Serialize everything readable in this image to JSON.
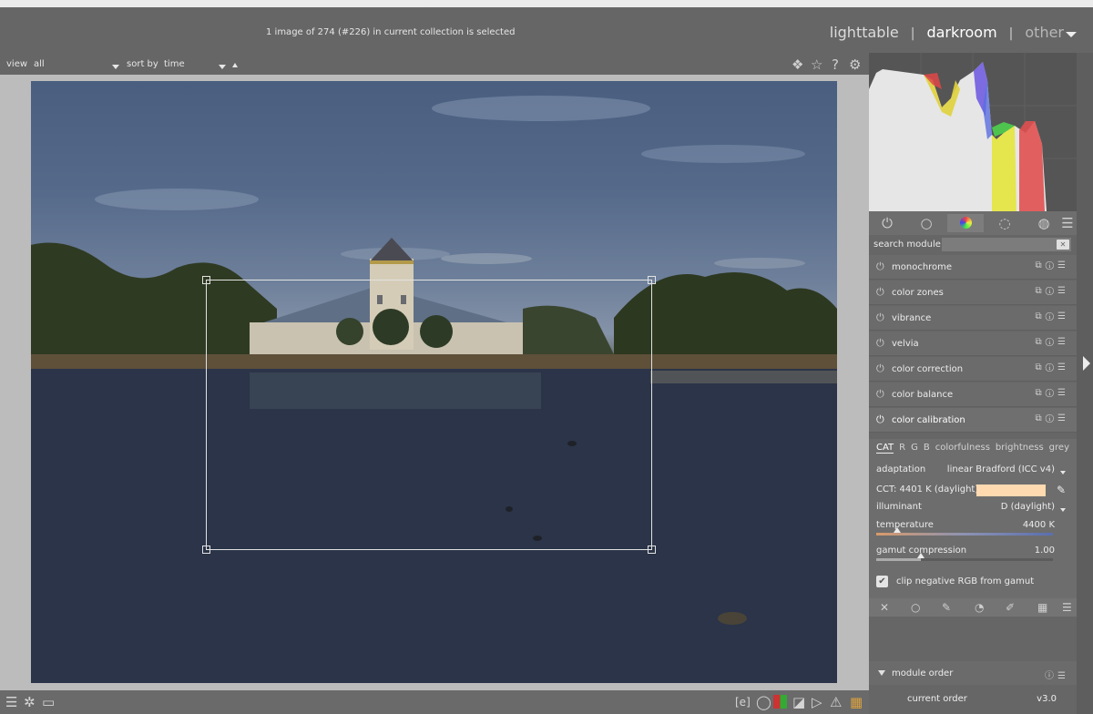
{
  "collection_status": "1 image of 274 (#226) in current collection is selected",
  "views": {
    "lighttable": "lighttable",
    "darkroom": "darkroom",
    "other": "other",
    "separator": "|"
  },
  "filterbar": {
    "view_label": "view",
    "view_value": "all",
    "sort_label": "sort by",
    "sort_value": "time"
  },
  "search": {
    "label": "search module",
    "value": ""
  },
  "modules": [
    {
      "name": "monochrome"
    },
    {
      "name": "color zones"
    },
    {
      "name": "vibrance"
    },
    {
      "name": "velvia"
    },
    {
      "name": "color correction"
    },
    {
      "name": "color balance"
    },
    {
      "name": "color calibration"
    }
  ],
  "color_calibration": {
    "tabs": [
      "CAT",
      "R",
      "G",
      "B",
      "colorfulness",
      "brightness",
      "grey"
    ],
    "adaptation_label": "adaptation",
    "adaptation_value": "linear Bradford (ICC v4)",
    "cct_label": "CCT: 4401 K (daylight)",
    "cct_color": "#ffd9b0",
    "illuminant_label": "illuminant",
    "illuminant_value": "D (daylight)",
    "temperature_label": "temperature",
    "temperature_value": "4400 K",
    "temperature_position": 0.12,
    "gamut_label": "gamut compression",
    "gamut_value": "1.00",
    "gamut_position": 0.25,
    "clip_label": "clip negative RGB from gamut",
    "clip_checked": true
  },
  "module_order": {
    "label": "module order",
    "current_label": "current order",
    "current_value": "v3.0"
  },
  "colors": {
    "accent_tab": "#7d7d7d",
    "panel_bg": "#666666",
    "canvas_bg": "#bcbcbc"
  }
}
